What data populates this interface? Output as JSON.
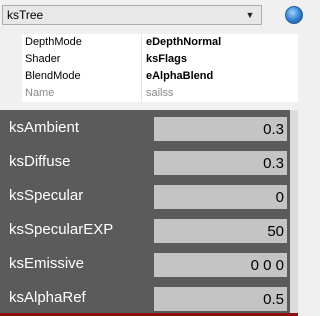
{
  "combo": {
    "value": "ksTree",
    "arrow_icon": "chevron-down-icon"
  },
  "properties": [
    {
      "name": "DepthMode",
      "value": "eDepthNormal",
      "readonly": false
    },
    {
      "name": "Shader",
      "value": "ksFlags",
      "readonly": false
    },
    {
      "name": "BlendMode",
      "value": "eAlphaBlend",
      "readonly": false
    },
    {
      "name": "Name",
      "value": "sailss",
      "readonly": true
    }
  ],
  "fields": [
    {
      "label": "ksAmbient",
      "value": "0.3"
    },
    {
      "label": "ksDiffuse",
      "value": "0.3"
    },
    {
      "label": "ksSpecular",
      "value": "0"
    },
    {
      "label": "ksSpecularEXP",
      "value": "50"
    },
    {
      "label": "ksEmissive",
      "value": "0 0 0"
    },
    {
      "label": "ksAlphaRef",
      "value": "0.5"
    }
  ],
  "colors": {
    "panel_bg": "#5b5b5b",
    "input_bg": "#c4c4c4",
    "bottom_accent": "#8b1010"
  }
}
